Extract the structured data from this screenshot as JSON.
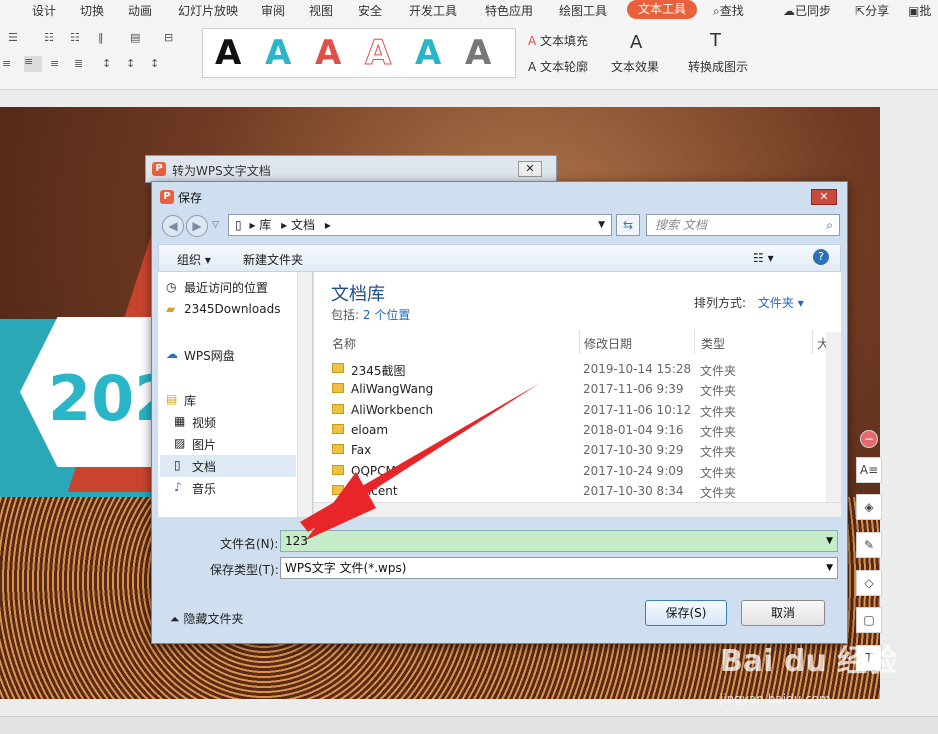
{
  "ribbon_tabs": [
    "设计",
    "切换",
    "动画",
    "幻灯片放映",
    "审阅",
    "视图",
    "安全",
    "开发工具",
    "特色应用",
    "绘图工具",
    "文本工具"
  ],
  "ribbon_right": {
    "search": "查找",
    "sync": "已同步",
    "share": "分享",
    "comment": "批"
  },
  "ribbon": {
    "text_fill": "文本填充",
    "text_outline": "文本轮廓",
    "text_effect": "文本效果",
    "convert": "转换成图示",
    "style_letters": [
      "A",
      "A",
      "A",
      "A",
      "A",
      "A"
    ],
    "style_colors": [
      "#111111",
      "#2ab6c6",
      "#e0504a",
      "#e0504a",
      "#2ab6c6",
      "#777777"
    ]
  },
  "outer_dialog": {
    "title": "转为WPS文字文档"
  },
  "save_dialog": {
    "title": "保存",
    "address": [
      "库",
      "文档"
    ],
    "search_placeholder": "搜索 文档",
    "toolbar": {
      "organize": "组织",
      "new_folder": "新建文件夹"
    },
    "nav": [
      {
        "label": "最近访问的位置",
        "icon": "recent-icon"
      },
      {
        "label": "2345Downloads",
        "icon": "folder-icon"
      },
      {
        "label": "WPS网盘",
        "icon": "cloud-icon"
      },
      {
        "label": "库",
        "icon": "library-icon"
      },
      {
        "label": "视频",
        "icon": "video-icon"
      },
      {
        "label": "图片",
        "icon": "picture-icon"
      },
      {
        "label": "文档",
        "icon": "document-icon",
        "selected": true
      },
      {
        "label": "音乐",
        "icon": "music-icon"
      }
    ],
    "library_title": "文档库",
    "library_sub_prefix": "包括:",
    "library_sub_link": "2 个位置",
    "sort_label": "排列方式:",
    "sort_value": "文件夹",
    "columns": [
      "名称",
      "修改日期",
      "类型",
      "大"
    ],
    "rows": [
      {
        "name": "2345截图",
        "date": "2019-10-14 15:28",
        "type": "文件夹"
      },
      {
        "name": "AliWangWang",
        "date": "2017-11-06 9:39",
        "type": "文件夹"
      },
      {
        "name": "AliWorkbench",
        "date": "2017-11-06 10:12",
        "type": "文件夹"
      },
      {
        "name": "eloam",
        "date": "2018-01-04 9:16",
        "type": "文件夹"
      },
      {
        "name": "Fax",
        "date": "2017-10-30 9:29",
        "type": "文件夹"
      },
      {
        "name": "QQPCM",
        "date": "2017-10-24 9:09",
        "type": "文件夹"
      },
      {
        "name": "Tencent",
        "date": "2017-10-30 8:34",
        "type": "文件夹"
      }
    ],
    "filename_label": "文件名(N):",
    "filename_value": "123",
    "filetype_label": "保存类型(T):",
    "filetype_value": "WPS文字 文件(*.wps)",
    "hide_folders": "隐藏文件夹",
    "save_button": "保存(S)",
    "cancel_button": "取消"
  },
  "slide": {
    "year": "202"
  },
  "watermark": {
    "logo": "Bai du 经验",
    "url": "jingyan.baidu.com"
  },
  "colors": {
    "accent": "#e8603c",
    "teal": "#2aa8b8",
    "selected_input": "#c7ecc8",
    "arrow": "#e8262a"
  }
}
